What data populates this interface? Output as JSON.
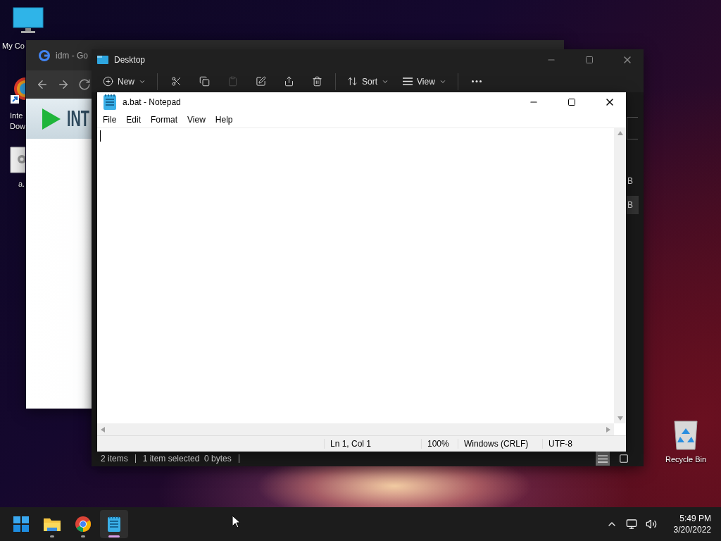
{
  "desktop_icons": [
    {
      "kind": "computer",
      "lines": [
        "My Co"
      ]
    },
    {
      "kind": "app",
      "lines": [
        "Inte",
        "Dow"
      ]
    },
    {
      "kind": "file",
      "lines": [
        "a."
      ]
    },
    {
      "kind": "recycle",
      "lines": [
        "Recycle Bin"
      ]
    }
  ],
  "browser": {
    "title": "idm - Go",
    "banner_text": "INT"
  },
  "explorer": {
    "title": "Desktop",
    "toolbar": [
      {
        "kind": "new",
        "label": "New"
      },
      {
        "kind": "cut",
        "disabled": false
      },
      {
        "kind": "copy",
        "disabled": false
      },
      {
        "kind": "paste",
        "disabled": true
      },
      {
        "kind": "rename",
        "disabled": false
      },
      {
        "kind": "share",
        "disabled": false
      },
      {
        "kind": "delete",
        "disabled": false
      },
      {
        "kind": "sort",
        "label": "Sort"
      },
      {
        "kind": "view",
        "label": "View"
      },
      {
        "kind": "more"
      }
    ],
    "rows": [
      {
        "text": "B",
        "selected": false
      },
      {
        "text": "B",
        "selected": true
      }
    ],
    "status": [
      "2 items",
      "1 item selected  0 bytes"
    ],
    "view_buttons": [
      {
        "kind": "details",
        "selected": true
      },
      {
        "kind": "tiles",
        "selected": false
      }
    ]
  },
  "notepad": {
    "title": "a.bat - Notepad",
    "menu": [
      "File",
      "Edit",
      "Format",
      "View",
      "Help"
    ],
    "status": [
      "Ln 1, Col 1",
      "100%",
      "Windows (CRLF)",
      "UTF-8"
    ]
  },
  "taskbar": {
    "apps": [
      {
        "kind": "start",
        "running": false,
        "selected": false
      },
      {
        "kind": "explorer",
        "running": true,
        "selected": false
      },
      {
        "kind": "chrome",
        "running": true,
        "selected": false
      },
      {
        "kind": "notepad",
        "running": true,
        "selected": true
      }
    ],
    "time": "5:49 PM",
    "date": "3/20/2022"
  }
}
